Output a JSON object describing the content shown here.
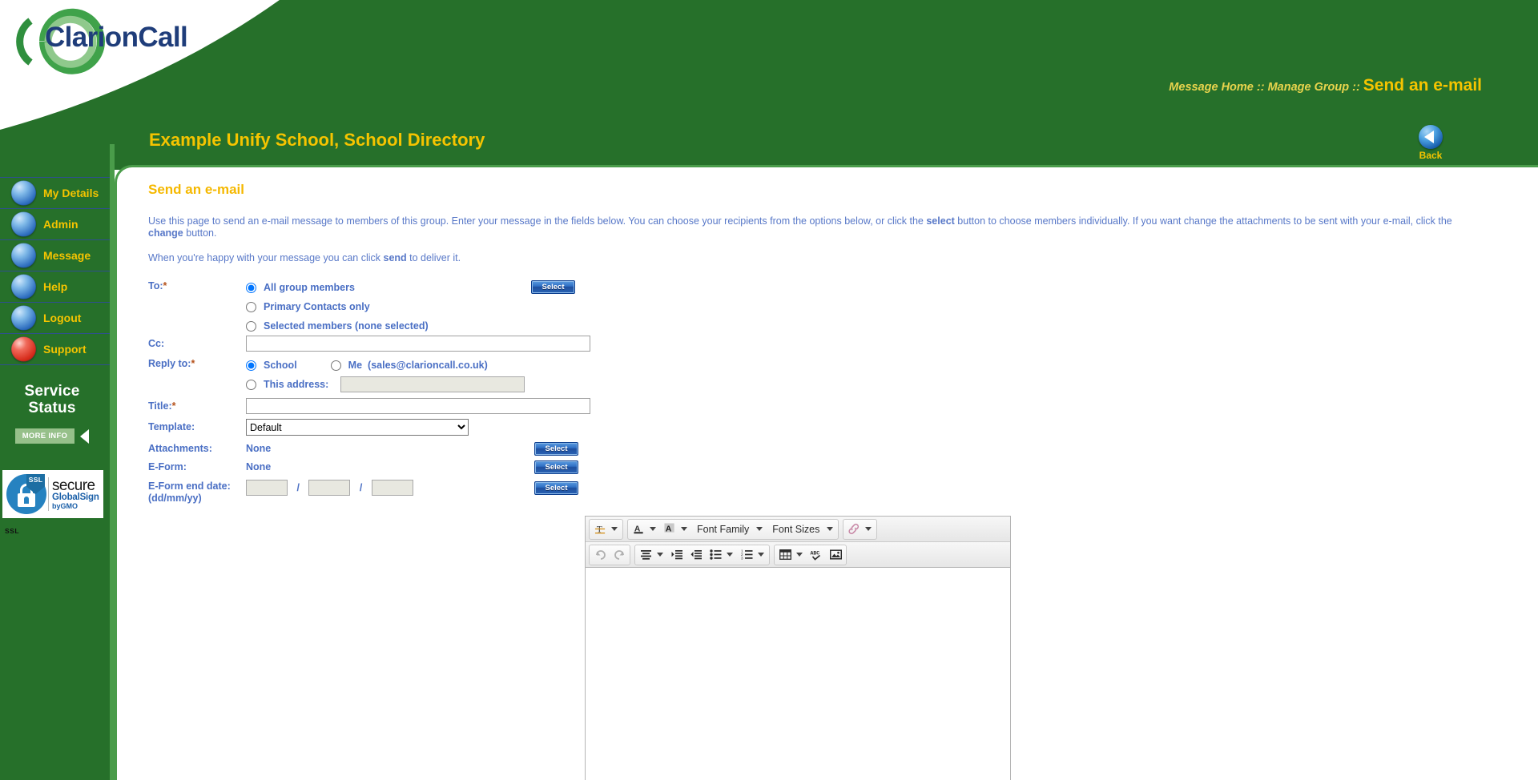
{
  "brand": {
    "logo_text": "ClarionCall"
  },
  "header": {
    "breadcrumb_path": "Message Home :: Manage Group ::",
    "breadcrumb_current": "Send an e-mail",
    "school_title": "Example Unify School, School Directory",
    "back_label": "Back"
  },
  "sidebar": {
    "items": [
      {
        "label": "My Details",
        "orb": "blue"
      },
      {
        "label": "Admin",
        "orb": "blue"
      },
      {
        "label": "Message",
        "orb": "blue"
      },
      {
        "label": "Help",
        "orb": "blue"
      },
      {
        "label": "Logout",
        "orb": "blue"
      },
      {
        "label": "Support",
        "orb": "red"
      }
    ],
    "service_status": {
      "line1": "Service",
      "line2": "Status",
      "more_info_label": "MORE INFO"
    },
    "ssl_badge": {
      "shield_text": "SSL",
      "secure_text": "secure",
      "brand_text": "GlobalSign",
      "by_text": "byGMO",
      "tiny_text": "SSL"
    }
  },
  "main": {
    "heading": "Send an e-mail",
    "intro_1a": "Use this page to send an e-mail message to members of this group. Enter your message in the fields below. You can choose your recipients from the options below, or click the ",
    "intro_1b": "select",
    "intro_1c": " button to choose members individually. If you want change the attachments to be sent with your e-mail, click the ",
    "intro_1d": "change",
    "intro_1e": " button.",
    "intro_2a": "When you're happy with your message you can click ",
    "intro_2b": "send",
    "intro_2c": " to deliver it."
  },
  "form": {
    "to": {
      "label": "To:",
      "required_mark": "*",
      "option_all": "All group members",
      "option_primary": "Primary Contacts only",
      "option_selected": "Selected members (none selected)",
      "select_button": "Select"
    },
    "cc": {
      "label": "Cc:",
      "value": "",
      "placeholder": ""
    },
    "reply_to": {
      "label": "Reply to:",
      "required_mark": "*",
      "option_school": "School",
      "option_me": "Me",
      "me_email": "(sales@clarioncall.co.uk)",
      "option_this_address": "This address:",
      "address_value": "",
      "address_placeholder": ""
    },
    "title": {
      "label": "Title:",
      "required_mark": "*",
      "value": "",
      "placeholder": ""
    },
    "template": {
      "label": "Template:",
      "selected": "Default",
      "options": [
        "Default"
      ]
    },
    "attachments": {
      "label": "Attachments:",
      "value": "None",
      "select_button": "Select"
    },
    "eform": {
      "label": "E-Form:",
      "value": "None",
      "select_button": "Select"
    },
    "eform_end_date": {
      "label_line1": "E-Form end date:",
      "label_line2": "(dd/mm/yy)",
      "day": "",
      "month": "",
      "year": "",
      "separator": "/",
      "select_button": "Select"
    }
  },
  "editor": {
    "toolbar_row1": [
      {
        "name": "clear-formatting-icon",
        "kind": "icon",
        "label": ""
      },
      {
        "name": "text-color-icon",
        "kind": "icon",
        "label": ""
      },
      {
        "name": "background-color-icon",
        "kind": "icon",
        "label": ""
      },
      {
        "name": "font-family-select",
        "kind": "text",
        "label": "Font Family"
      },
      {
        "name": "font-sizes-select",
        "kind": "text",
        "label": "Font Sizes"
      },
      {
        "name": "link-icon",
        "kind": "icon",
        "label": ""
      }
    ],
    "toolbar_row2": [
      {
        "name": "undo-icon",
        "kind": "icon",
        "label": ""
      },
      {
        "name": "redo-icon",
        "kind": "icon",
        "label": ""
      },
      {
        "name": "align-icon",
        "kind": "icon",
        "label": ""
      },
      {
        "name": "indent-icon",
        "kind": "icon",
        "label": ""
      },
      {
        "name": "outdent-icon",
        "kind": "icon",
        "label": ""
      },
      {
        "name": "bullet-list-icon",
        "kind": "icon",
        "label": ""
      },
      {
        "name": "numbered-list-icon",
        "kind": "icon",
        "label": ""
      },
      {
        "name": "table-icon",
        "kind": "icon",
        "label": ""
      },
      {
        "name": "spellcheck-icon",
        "kind": "icon",
        "label": ""
      },
      {
        "name": "insert-image-icon",
        "kind": "icon",
        "label": ""
      }
    ],
    "body_value": ""
  },
  "colors": {
    "brand_green": "#26702a",
    "light_green_border": "#4a9c4a",
    "gold": "#f5c400",
    "heading_gold": "#f5b800",
    "label_blue": "#4a6fc4",
    "text_blue": "#5878c8",
    "required_orange": "#b5521c",
    "logo_navy": "#1f3d7a",
    "button_blue": "#2f6fc4"
  }
}
